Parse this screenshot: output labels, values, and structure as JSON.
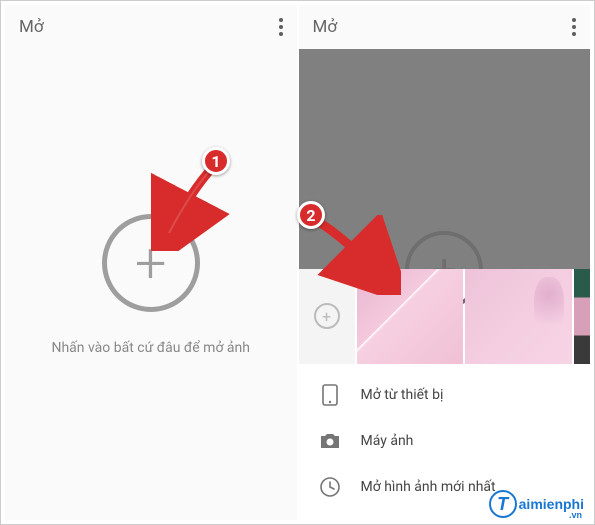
{
  "left": {
    "title": "Mở",
    "hint": "Nhấn vào bất cứ đâu để mở ảnh"
  },
  "right": {
    "title": "Mở",
    "menu": {
      "device": "Mở từ thiết bị",
      "camera": "Máy ảnh",
      "recent": "Mở hình ảnh mới nhất"
    }
  },
  "annotations": {
    "badge1": "1",
    "badge2": "2"
  },
  "watermark": {
    "letter": "T",
    "text": "aimienphi",
    "suffix": ".vn"
  }
}
